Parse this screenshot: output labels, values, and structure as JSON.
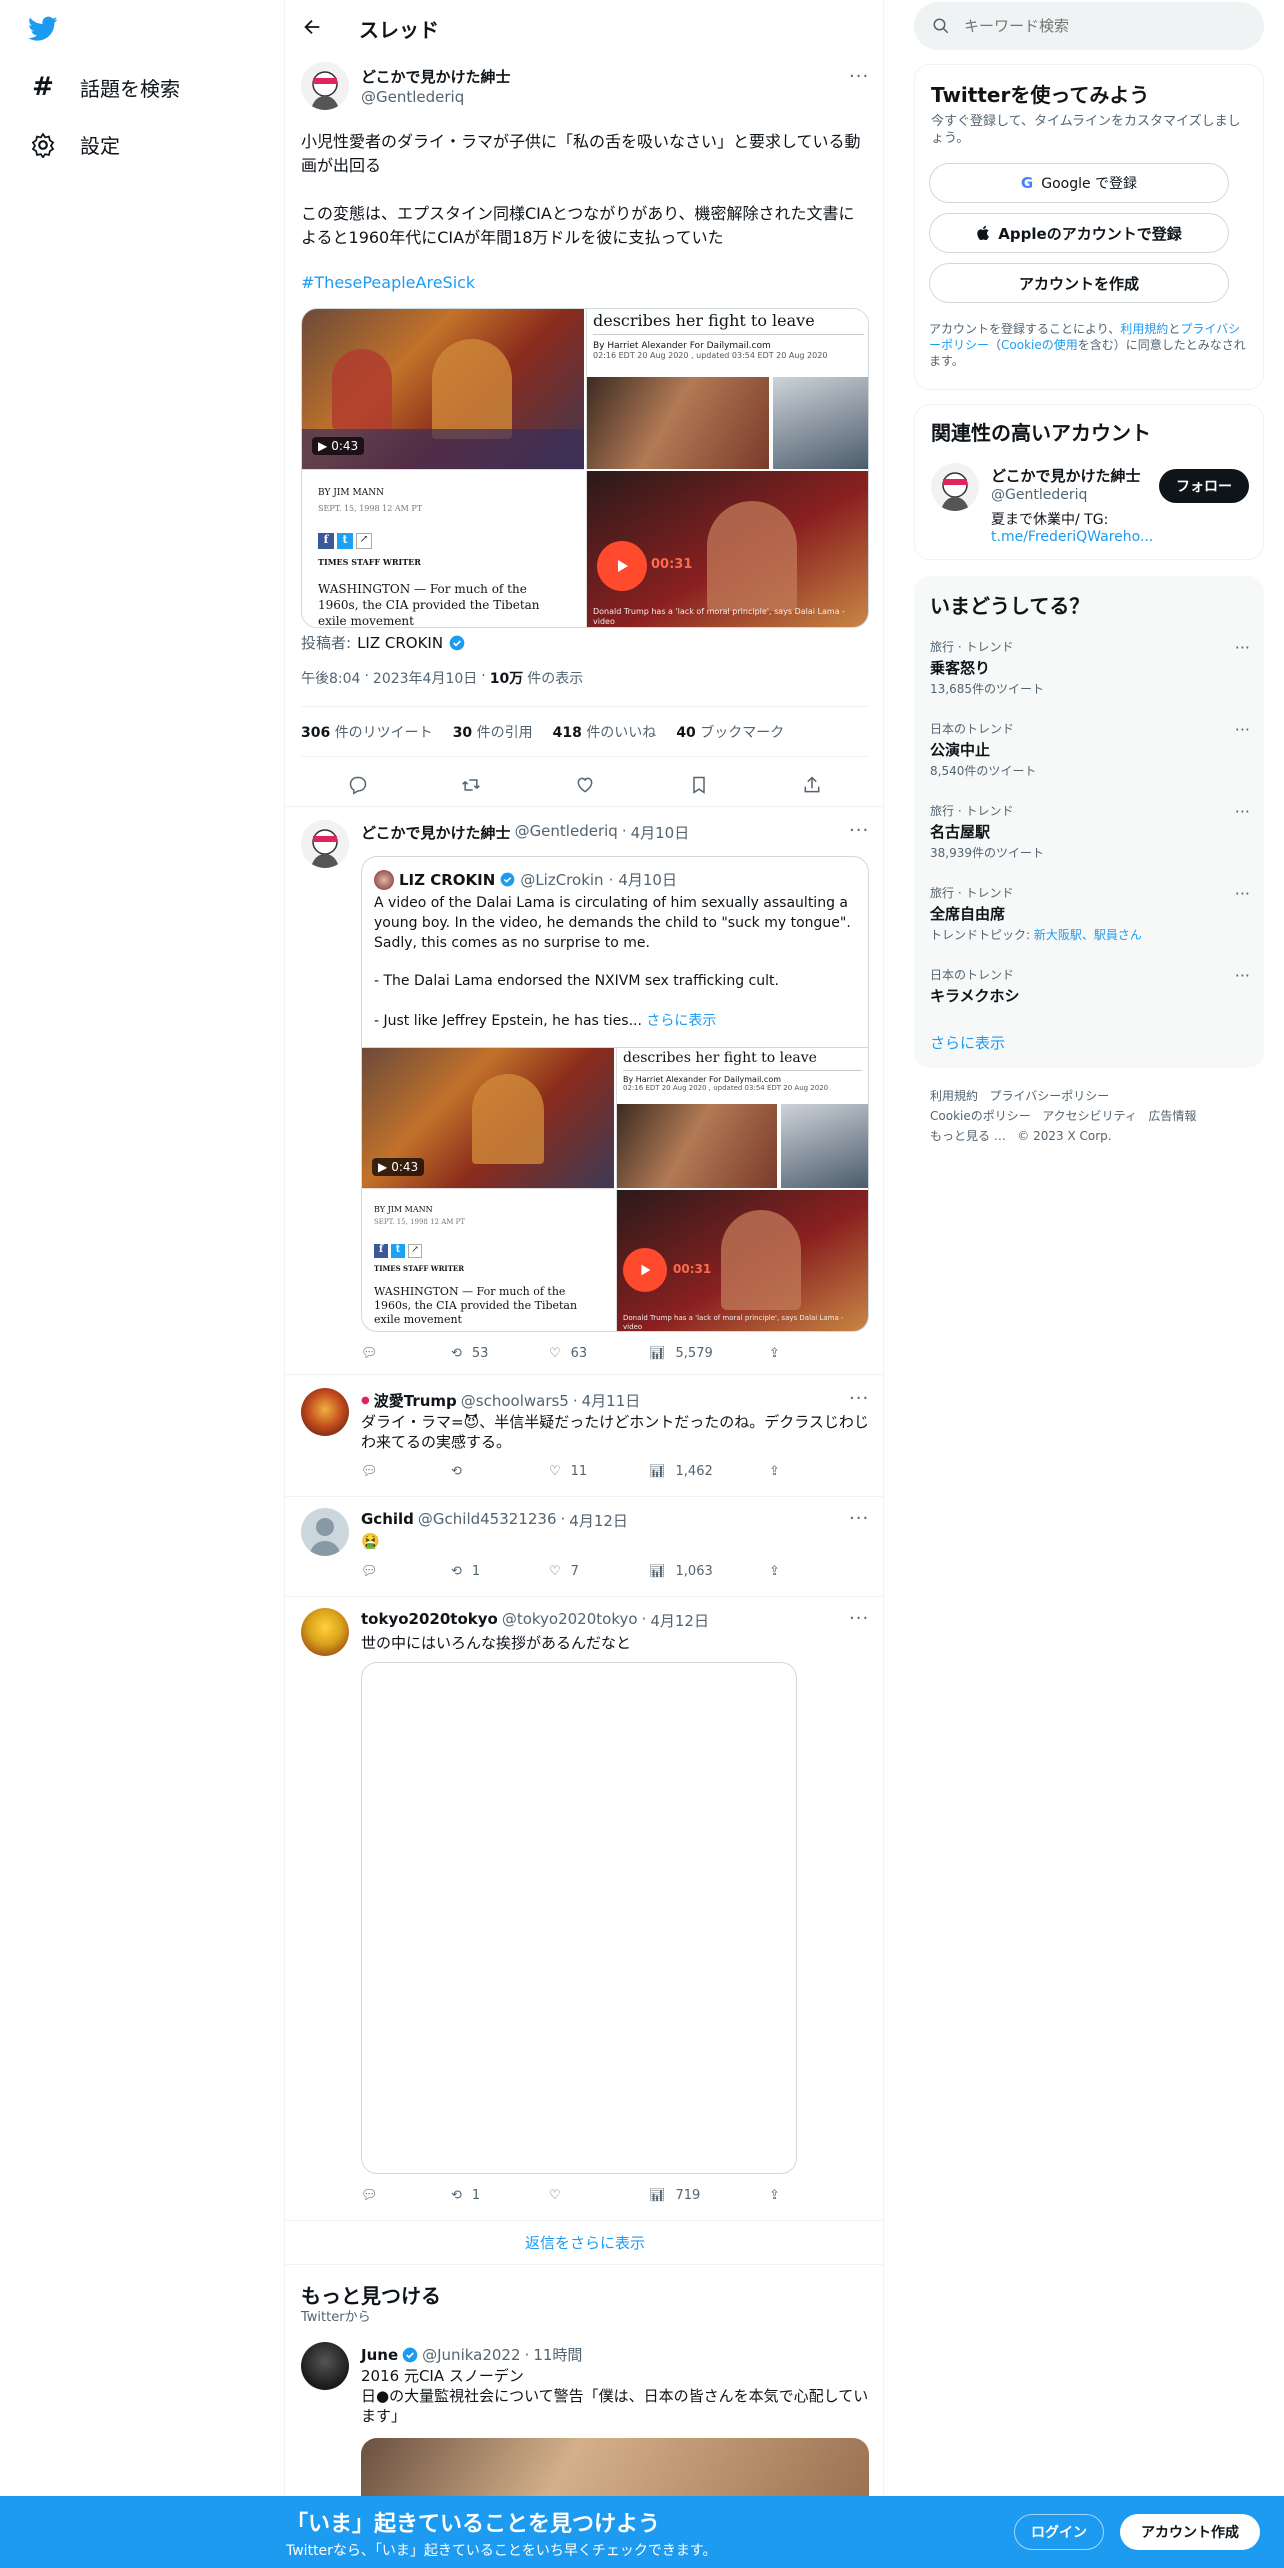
{
  "nav": {
    "explore_label": "話題を検索",
    "settings_label": "設定"
  },
  "header": {
    "title": "スレッド"
  },
  "main_tweet": {
    "author_name": "どこかで見かけた紳士",
    "author_handle": "@Gentlederiq",
    "text_line1": "小児性愛者のダライ・ラマが子供に「私の舌を吸いなさい」と要求している動画が出回る",
    "text_line2": "この変態は、エプスタイン同様CIAとつながりがあり、機密解除された文書によると1960年代にCIAが年間18万ドルを彼に支払っていた",
    "hashtag": "#ThesePeapleAreSick",
    "video_duration": "0:43",
    "clip_duration": "00:31",
    "article_headline": "describes her fight to leave",
    "article_byline": "By Harriet Alexander For Dailymail.com",
    "article_dates": "02:16 EDT 20 Aug 2020 , updated 03:54 EDT 20 Aug 2020",
    "article_caption": "Donald Trump has a 'lack of moral principle', says Dalai Lama - video",
    "clip_by": "BY JIM MANN",
    "clip_date": "SEPT. 15, 1998 12 AM PT",
    "clip_staff": "TIMES STAFF WRITER",
    "clip_body": "WASHINGTON —  For much of the 1960s, the CIA provided the Tibetan exile movement",
    "poster_label": "投稿者:",
    "poster_name": "LIZ CROKIN",
    "time": "午後8:04",
    "date": "2023年4月10日",
    "views_count": "10万",
    "views_label": "件の表示",
    "retweets_count": "306",
    "retweets_label": "件のリツイート",
    "quotes_count": "30",
    "quotes_label": "件の引用",
    "likes_count": "418",
    "likes_label": "件のいいね",
    "bookmarks_count": "40",
    "bookmarks_label": "ブックマーク"
  },
  "replies": [
    {
      "name": "どこかで見かけた紳士",
      "handle": "@Gentlederiq",
      "date": "4月10日",
      "quote_name": "LIZ CROKIN",
      "quote_handle": "@LizCrokin",
      "quote_date": "4月10日",
      "quote_text_1": "A video of the Dalai Lama is circulating of him sexually assaulting a young boy. In the video, he demands the child to \"suck my tongue\". Sadly, this comes as no surprise to me.",
      "quote_text_2": "- The Dalai Lama endorsed the NXIVM sex trafficking cult.",
      "quote_text_3": "- Just like Jeffrey Epstein, he has ties...",
      "show_more": "さらに表示",
      "retweets": "53",
      "likes": "63",
      "views": "5,579"
    },
    {
      "name": "波愛Trump",
      "handle": "@schoolwars5",
      "date": "4月11日",
      "text": "ダライ・ラマ=😈、半信半疑だったけどホントだったのね。デクラスじわじわ来てるの実感する。",
      "retweets": "",
      "likes": "11",
      "views": "1,462"
    },
    {
      "name": "Gchild",
      "handle": "@Gchild45321236",
      "date": "4月12日",
      "text": "🤮",
      "retweets": "1",
      "likes": "7",
      "views": "1,063"
    },
    {
      "name": "tokyo2020tokyo",
      "handle": "@tokyo2020tokyo",
      "date": "4月12日",
      "text": "世の中にはいろんな挨拶があるんだなと",
      "retweets": "1",
      "likes": "",
      "views": "719"
    }
  ],
  "more_replies_label": "返信をさらに表示",
  "discover": {
    "title": "もっと見つける",
    "subtitle": "Twitterから",
    "tweet_name": "June",
    "tweet_handle": "@Junika2022",
    "tweet_time": "11時間",
    "tweet_text_1": "2016 元CIA スノーデン",
    "tweet_text_2": "日●の大量監視社会について警告「僕は、日本の皆さんを本気で心配しています」"
  },
  "search": {
    "placeholder": "キーワード検索"
  },
  "signup": {
    "title": "Twitterを使ってみよう",
    "subtitle": "今すぐ登録して、タイムラインをカスタマイズしましょう。",
    "google_label": "Google で登録",
    "apple_label": "Appleのアカウントで登録",
    "create_label": "アカウントを作成",
    "terms_prefix": "アカウントを登録することにより、",
    "terms_link": "利用規約",
    "terms_mid": "と",
    "privacy_link": "プライバシーポリシー",
    "cookie_open": "（",
    "cookie_link": "Cookieの使用",
    "terms_suffix": "を含む）に同意したとみなされます。"
  },
  "relevant": {
    "title": "関連性の高いアカウント",
    "name": "どこかで見かけた紳士",
    "handle": "@Gentlederiq",
    "bio": "夏まで休業中/ TG:",
    "link": "t.me/FrederiQWareho...",
    "follow_label": "フォロー"
  },
  "trends": {
    "title": "いまどうしてる？",
    "items": [
      {
        "context": "旅行 · トレンド",
        "name": "乗客怒り",
        "count": "13,685件のツイート"
      },
      {
        "context": "日本のトレンド",
        "name": "公演中止",
        "count": "8,540件のツイート"
      },
      {
        "context": "旅行 · トレンド",
        "name": "名古屋駅",
        "count": "38,939件のツイート"
      },
      {
        "context": "旅行 · トレンド",
        "name": "全席自由席",
        "count": "トレンドトピック: ",
        "topics": "新大阪駅、駅員さん"
      },
      {
        "context": "日本のトレンド",
        "name": "キラメクホシ",
        "count": ""
      }
    ],
    "show_more": "さらに表示"
  },
  "footer": {
    "terms": "利用規約",
    "privacy": "プライバシーポリシー",
    "cookie": "Cookieのポリシー",
    "accessibility": "アクセシビリティ",
    "ads": "広告情報",
    "more": "もっと見る …",
    "copyright": "© 2023 X Corp."
  },
  "banner": {
    "title": "「いま」起きていることを見つけよう",
    "subtitle": "Twitterなら、「いま」起きていることをいち早くチェックできます。",
    "login_label": "ログイン",
    "signup_label": "アカウント作成"
  },
  "colors": {
    "accent": "#1d9bf0",
    "text": "#0f1419",
    "secondary": "#536471"
  }
}
